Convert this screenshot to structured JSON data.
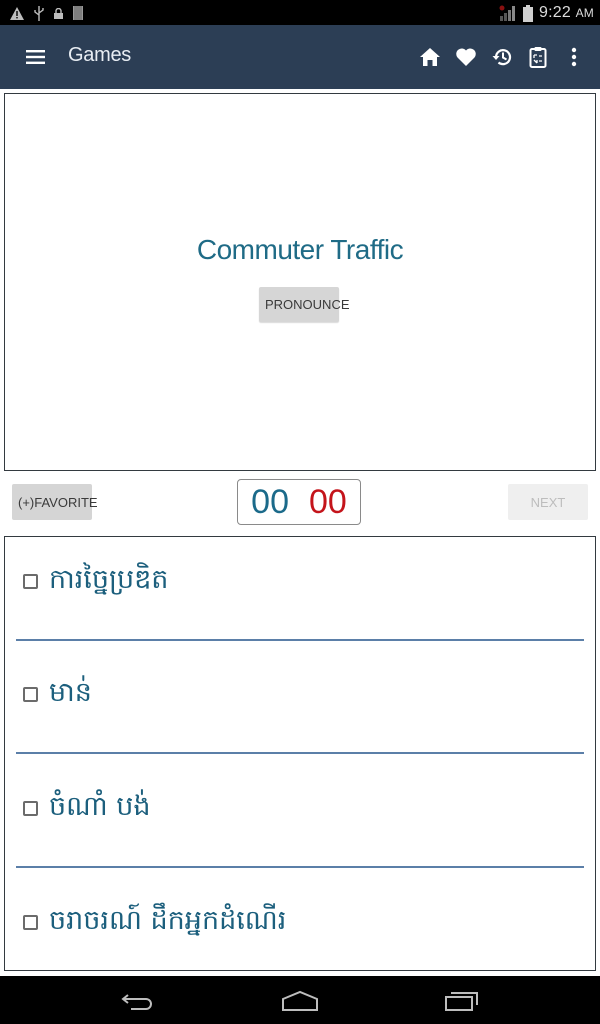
{
  "status_bar": {
    "icons": [
      "warning-icon",
      "usb-icon",
      "lock-icon",
      "sim-card-icon",
      "signal-icon",
      "battery-icon"
    ],
    "time": "9:22",
    "ampm": "AM"
  },
  "app_bar": {
    "title": "Games",
    "actions": [
      "home-icon",
      "heart-icon",
      "history-icon",
      "clipboard-icon",
      "more-vert-icon"
    ],
    "background": "#2c3e55"
  },
  "card": {
    "word": "Commuter Traffic",
    "pronounce_label": "PRONOUNCE"
  },
  "controls": {
    "favorite_label": "(+)FAVORITE",
    "timer_minutes": "00",
    "timer_seconds": "00",
    "next_label": "NEXT",
    "next_enabled": false
  },
  "options": [
    {
      "label": "ការច្នៃប្រឌិត",
      "checked": false
    },
    {
      "label": "មាន់",
      "checked": false
    },
    {
      "label": "ចំណាំ បង់",
      "checked": false
    },
    {
      "label": "ចរាចរណ៍ ដឹកអ្នកដំណើរ",
      "checked": false
    }
  ],
  "nav_bar": {
    "buttons": [
      "back-icon",
      "home-nav-icon",
      "recents-icon"
    ]
  },
  "colors": {
    "accent_text": "#1f6b86",
    "timer_seconds": "#c4141b",
    "separator": "#5b7fa8"
  }
}
